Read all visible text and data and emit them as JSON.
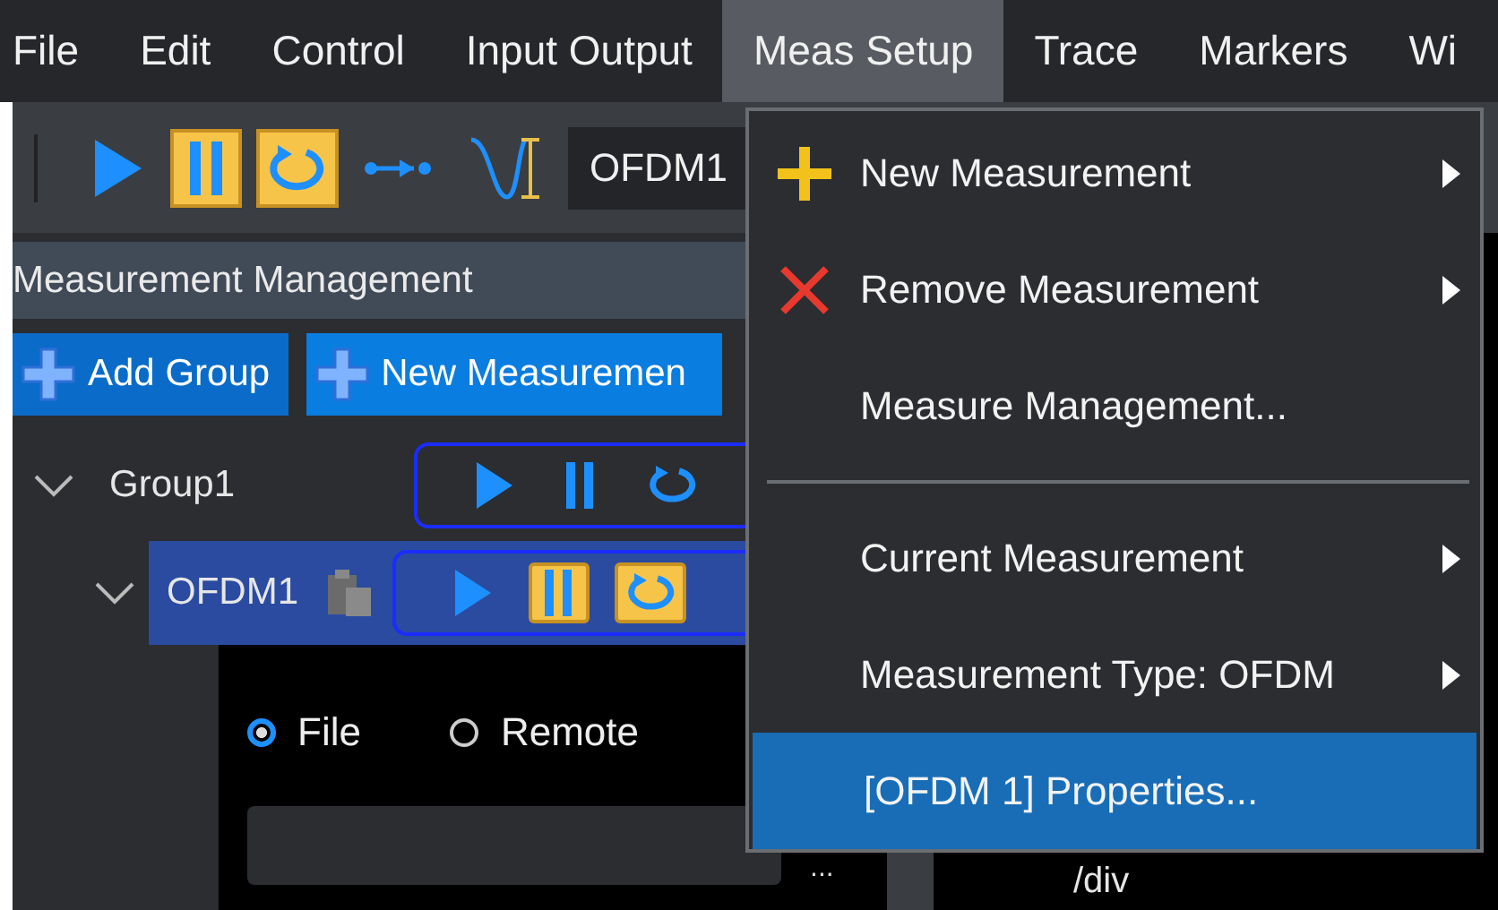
{
  "menubar": [
    {
      "label": "File",
      "selected": false
    },
    {
      "label": "Edit",
      "selected": false
    },
    {
      "label": "Control",
      "selected": false
    },
    {
      "label": "Input Output",
      "selected": false
    },
    {
      "label": "Meas Setup",
      "selected": true
    },
    {
      "label": "Trace",
      "selected": false
    },
    {
      "label": "Markers",
      "selected": false
    },
    {
      "label": "Wi",
      "selected": false
    }
  ],
  "toolbar": {
    "buttons": [
      {
        "kind": "play",
        "active": false
      },
      {
        "kind": "pause",
        "active": true
      },
      {
        "kind": "loop",
        "active": true
      },
      {
        "kind": "step",
        "active": false
      },
      {
        "kind": "wave",
        "active": false
      }
    ],
    "measurement": "OFDM1"
  },
  "panel": {
    "title": "Measurement Management",
    "buttons": [
      {
        "label": "Add Group"
      },
      {
        "label": "New Measuremen"
      }
    ],
    "tree": [
      {
        "label": "Group1",
        "expanded": true,
        "selected": false,
        "controls": [
          {
            "kind": "play",
            "active": false
          },
          {
            "kind": "pause",
            "active": false
          },
          {
            "kind": "loop",
            "active": false
          }
        ],
        "children": [
          {
            "label": "OFDM1",
            "expanded": true,
            "selected": true,
            "controls": [
              {
                "kind": "play",
                "active": false
              },
              {
                "kind": "pause",
                "active": true
              },
              {
                "kind": "loop",
                "active": true
              }
            ]
          }
        ]
      }
    ],
    "source": {
      "options": [
        {
          "label": "File",
          "selected": true
        },
        {
          "label": "Remote",
          "selected": false
        }
      ],
      "browse": "..."
    }
  },
  "chart": {
    "unit_label": "/div"
  },
  "menu": {
    "items": [
      {
        "kind": "add",
        "label": "New Measurement",
        "submenu": true,
        "selected": false
      },
      {
        "kind": "remove",
        "label": "Remove Measurement",
        "submenu": true,
        "selected": false
      },
      {
        "kind": "item",
        "label": "Measure Management...",
        "submenu": false,
        "selected": false
      },
      {
        "kind": "separator"
      },
      {
        "kind": "item",
        "label": "Current Measurement",
        "submenu": true,
        "selected": false
      },
      {
        "kind": "item",
        "label": "Measurement Type: OFDM",
        "submenu": true,
        "selected": false
      },
      {
        "kind": "item",
        "label": "[OFDM 1] Properties...",
        "submenu": false,
        "selected": true
      }
    ]
  }
}
